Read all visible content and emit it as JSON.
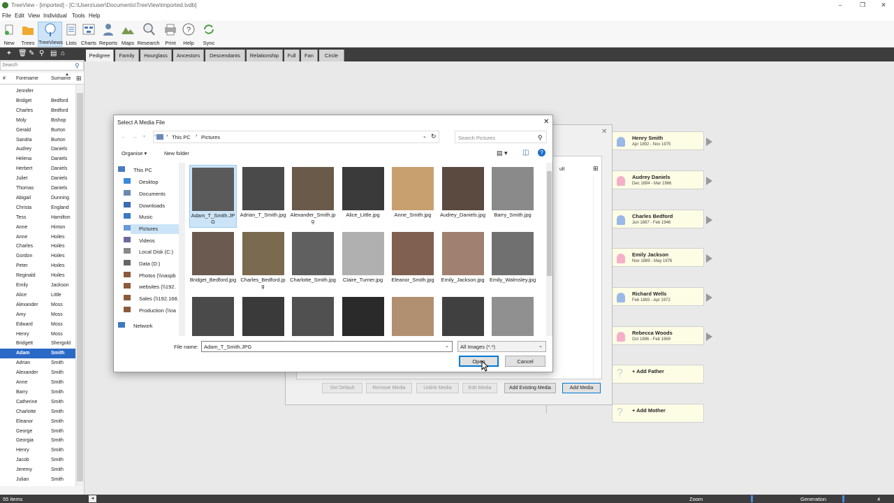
{
  "window": {
    "title": "TreeView - [imported] - [C:\\Users\\user\\Documents\\TreeView\\imported.tvdb]"
  },
  "menu": [
    "File",
    "Edit",
    "View",
    "Individual",
    "Tools",
    "Help"
  ],
  "toolbar": [
    "New",
    "Trees",
    "TreeViews",
    "Lists",
    "Charts",
    "Reports",
    "Maps",
    "Research",
    "Print",
    "Help",
    "Sync"
  ],
  "left_panel": {
    "search_placeholder": "Search",
    "col_hash": "#",
    "col_forename": "Forename",
    "col_surname": "Surname",
    "rows": [
      {
        "f": "Jennifer",
        "s": ""
      },
      {
        "f": "Bridget",
        "s": "Bedford"
      },
      {
        "f": "Charles",
        "s": "Bedford"
      },
      {
        "f": "Moly",
        "s": "Bishop"
      },
      {
        "f": "Gerald",
        "s": "Burton"
      },
      {
        "f": "Sandra",
        "s": "Burton"
      },
      {
        "f": "Audrey",
        "s": "Daniels"
      },
      {
        "f": "Helena",
        "s": "Daniels"
      },
      {
        "f": "Herbert",
        "s": "Daniels"
      },
      {
        "f": "Juliet",
        "s": "Daniels"
      },
      {
        "f": "Thomas",
        "s": "Daniels"
      },
      {
        "f": "Abigail",
        "s": "Dunning"
      },
      {
        "f": "Christa",
        "s": "England"
      },
      {
        "f": "Tess",
        "s": "Hamilton"
      },
      {
        "f": "Anne",
        "s": "Hinton"
      },
      {
        "f": "Anne",
        "s": "Hoiles"
      },
      {
        "f": "Charles",
        "s": "Hoiles"
      },
      {
        "f": "Gordon",
        "s": "Hoiles"
      },
      {
        "f": "Peter",
        "s": "Hoiles"
      },
      {
        "f": "Reginald",
        "s": "Hoiles"
      },
      {
        "f": "Emily",
        "s": "Jackson"
      },
      {
        "f": "Alice",
        "s": "Little"
      },
      {
        "f": "Alexander",
        "s": "Moss"
      },
      {
        "f": "Amy",
        "s": "Moss"
      },
      {
        "f": "Edward",
        "s": "Moss"
      },
      {
        "f": "Henry",
        "s": "Moss"
      },
      {
        "f": "Bridgett",
        "s": "Shergold"
      },
      {
        "f": "Adam",
        "s": "Smith"
      },
      {
        "f": "Adrian",
        "s": "Smith"
      },
      {
        "f": "Alexander",
        "s": "Smith"
      },
      {
        "f": "Anne",
        "s": "Smith"
      },
      {
        "f": "Barry",
        "s": "Smith"
      },
      {
        "f": "Catherine",
        "s": "Smith"
      },
      {
        "f": "Charlotte",
        "s": "Smith"
      },
      {
        "f": "Eleanor",
        "s": "Smith"
      },
      {
        "f": "George",
        "s": "Smith"
      },
      {
        "f": "Georgia",
        "s": "Smith"
      },
      {
        "f": "Henry",
        "s": "Smith"
      },
      {
        "f": "Jacob",
        "s": "Smith"
      },
      {
        "f": "Jeremy",
        "s": "Smith"
      },
      {
        "f": "Julian",
        "s": "Smith"
      }
    ],
    "selected_index": 27,
    "count": "55 items"
  },
  "tabs": [
    "Pedigree",
    "Family",
    "Hourglass",
    "Ancestors",
    "Descendants",
    "Relationship",
    "Full",
    "Fan",
    "Circle"
  ],
  "tree_cards": [
    {
      "name": "Henry Smith",
      "dates": "Apr 1892 - Nov 1975",
      "sex": "m"
    },
    {
      "name": "Audrey Daniels",
      "dates": "Dec 1894 - Mar 1966",
      "sex": "f"
    },
    {
      "name": "Charles Bedford",
      "dates": "Jun 1887 - Feb 1946",
      "sex": "m"
    },
    {
      "name": "Emily Jackson",
      "dates": "Nov 1889 - May 1976",
      "sex": "f"
    },
    {
      "name": "Richard Wells",
      "dates": "Feb 1893 - Apr 1972",
      "sex": "m"
    },
    {
      "name": "Rebecca Woods",
      "dates": "Oct 1896 - Feb 1969",
      "sex": "f"
    },
    {
      "name": "+ Add Father",
      "dates": "",
      "sex": "u"
    },
    {
      "name": "+ Add Mother",
      "dates": "",
      "sex": "u"
    }
  ],
  "media_dialog": {
    "field_text": "ult",
    "buttons": [
      {
        "label": "Set Default",
        "enabled": false
      },
      {
        "label": "Remove Media",
        "enabled": false
      },
      {
        "label": "Unlink Media",
        "enabled": false
      },
      {
        "label": "Edit Media",
        "enabled": false
      },
      {
        "label": "Add Existing Media",
        "enabled": true
      },
      {
        "label": "Add Media",
        "enabled": true
      }
    ]
  },
  "file_dialog": {
    "title": "Select A Media File",
    "path": [
      "This PC",
      "Pictures"
    ],
    "search_placeholder": "Search Pictures",
    "organise": "Organise",
    "new_folder": "New folder",
    "nav": [
      "This PC",
      "Desktop",
      "Documents",
      "Downloads",
      "Music",
      "Pictures",
      "Videos",
      "Local Disk (C:)",
      "Data (D:)",
      "Photos (\\\\naspb",
      "websites (\\\\192.",
      "Sales (\\\\192.168.",
      "Production (\\\\na",
      "Network"
    ],
    "selected_nav": 5,
    "files": [
      "Adam_T_Smith.JPG",
      "Adrian_T_Smith.jpg",
      "Alexander_Smith.jpg",
      "Alice_Little.jpg",
      "Anne_Smith.jpg",
      "Audrey_Daniels.jpg",
      "Barry_Smith.jpg",
      "Bridget_Bedford.jpg",
      "Charles_Bedford.jpg",
      "Charlotte_Smith.jpg",
      "Claire_Turner.jpg",
      "Eleanor_Smith.jpg",
      "Emily_Jackson.jpg",
      "Emily_Walmsley.jpg",
      "",
      "",
      "",
      "",
      "",
      "",
      ""
    ],
    "file_name_label": "File name:",
    "file_name_value": "Adam_T_Smith.JPG",
    "filter": "All Images (*.*)",
    "open": "Open",
    "cancel": "Cancel"
  },
  "status": {
    "count": "55 items",
    "zoom": "Zoom",
    "generation": "Generation",
    "gen_value": "4"
  }
}
